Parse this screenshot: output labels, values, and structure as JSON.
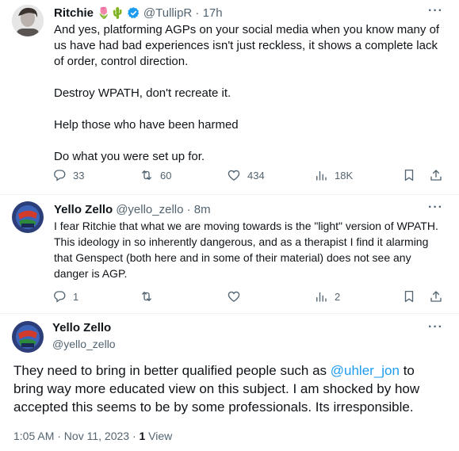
{
  "tweet1": {
    "name": "Ritchie",
    "emojis": "🌷🌵",
    "handle_time": "@TullipR · 17h",
    "text": "And yes, platforming AGPs on your social media when you know many of us have had bad experiences isn't just reckless, it shows a complete lack of order, control direction.\n\nDestroy WPATH, don't recreate it.\n\nHelp those who have been harmed\n\nDo what you were set up for.",
    "replies": "33",
    "reposts": "60",
    "likes": "434",
    "views": "18K"
  },
  "tweet2": {
    "name": "Yello Zello",
    "handle_time": "@yello_zello · 8m",
    "text": "I fear Ritchie that what we are moving towards is the \"light\" version of WPATH. This ideology in so inherently dangerous, and as a therapist I find it alarming that Genspect (both here and in some of their material) does not see any danger is AGP.",
    "replies": "1",
    "views": "2"
  },
  "tweet3": {
    "name": "Yello Zello",
    "handle": "@yello_zello",
    "text_before": "They need to bring in better qualified people such as ",
    "mention": "@uhler_jon",
    "text_after": " to bring way more educated view on this  subject. I am shocked by how accepted this seems to be by some professionals. Its irresponsible.",
    "time": "1:05 AM · Nov 11, 2023 · ",
    "view_count": "1",
    "view_label": " View"
  },
  "more_glyph": "···",
  "colors": {
    "accent": "#1d9bf0",
    "verified": "#1d9bf0",
    "secondary": "#536471"
  }
}
